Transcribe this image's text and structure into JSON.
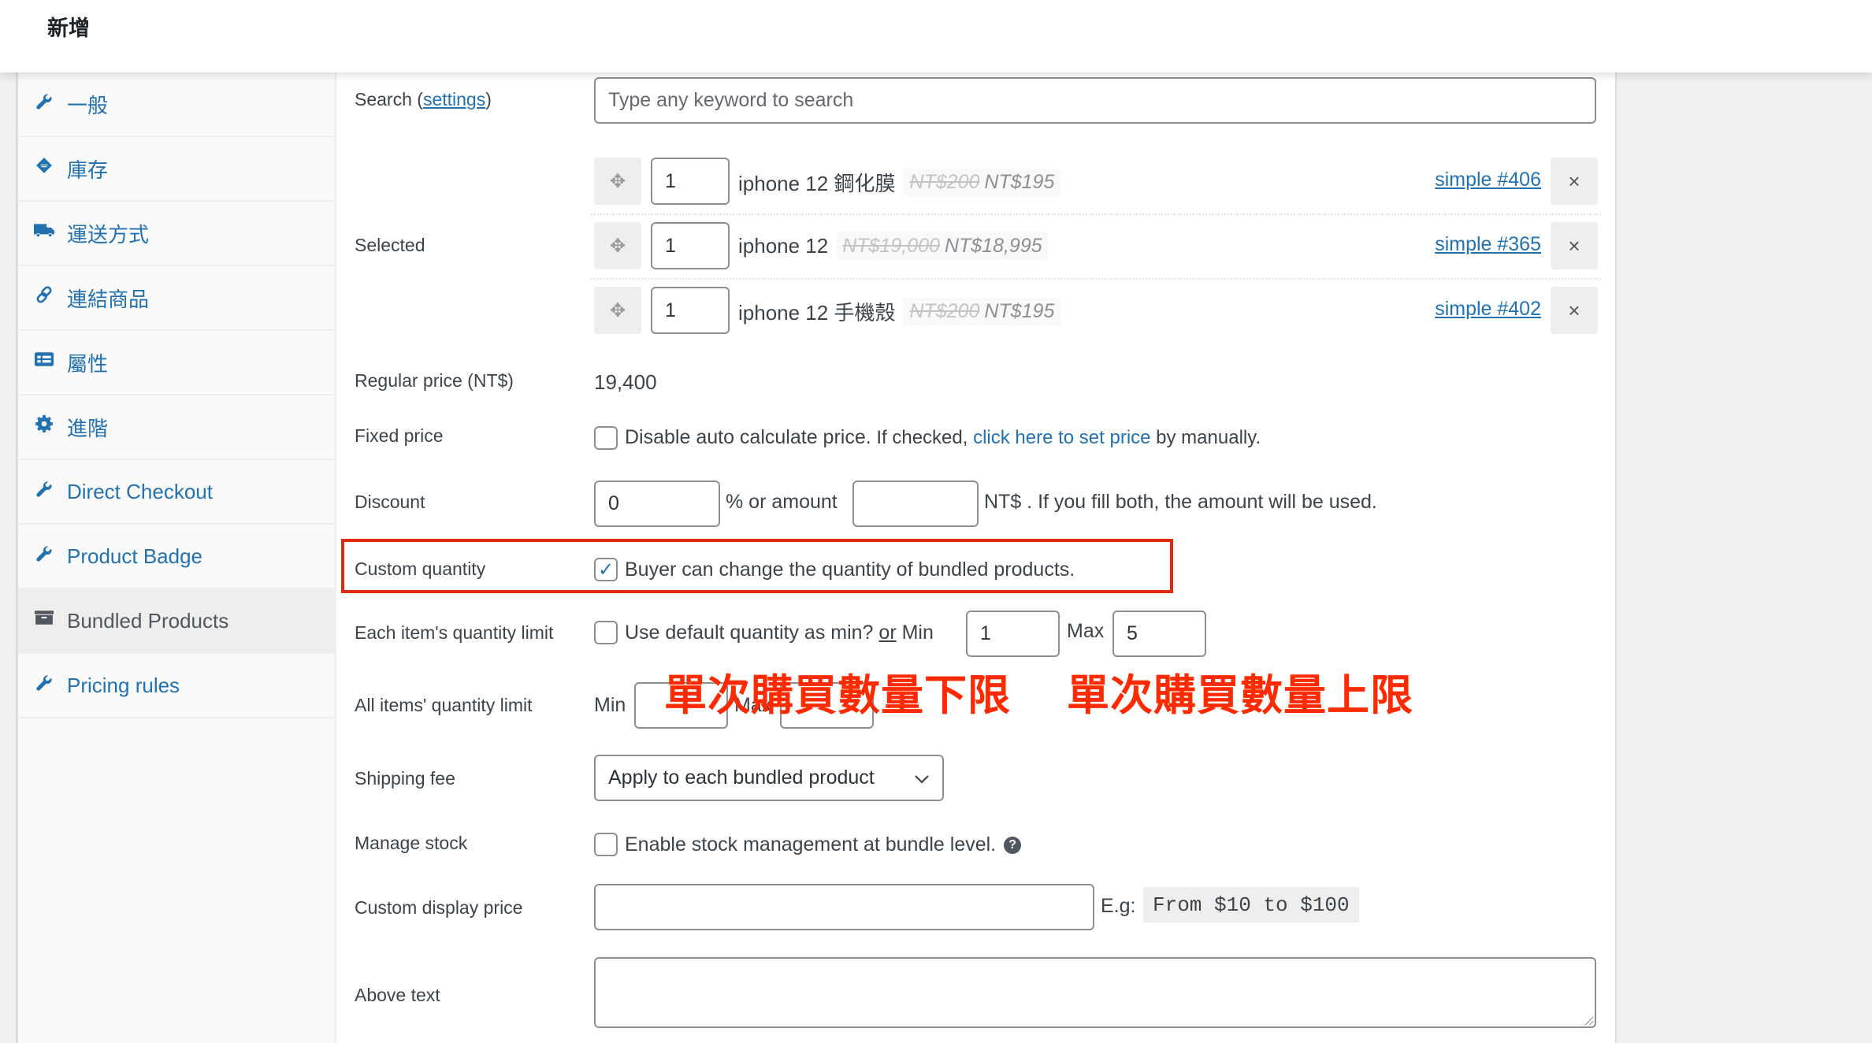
{
  "header": {
    "title": "新增"
  },
  "sidebar": {
    "items": [
      {
        "label": "一般",
        "icon": "wrench-icon",
        "active": false
      },
      {
        "label": "庫存",
        "icon": "tag-icon",
        "active": false
      },
      {
        "label": "運送方式",
        "icon": "truck-icon",
        "active": false
      },
      {
        "label": "連結商品",
        "icon": "link-icon",
        "active": false
      },
      {
        "label": "屬性",
        "icon": "list-icon",
        "active": false
      },
      {
        "label": "進階",
        "icon": "gear-icon",
        "active": false
      },
      {
        "label": "Direct Checkout",
        "icon": "wrench-icon",
        "active": false
      },
      {
        "label": "Product Badge",
        "icon": "wrench-icon",
        "active": false
      },
      {
        "label": "Bundled Products",
        "icon": "archive-box-icon",
        "active": true
      },
      {
        "label": "Pricing rules",
        "icon": "wrench-icon",
        "active": false
      }
    ]
  },
  "search": {
    "label": "Search (",
    "settings_link": "settings",
    "label_end": ")",
    "placeholder": "Type any keyword to search"
  },
  "selected": {
    "label": "Selected",
    "products": [
      {
        "qty": "1",
        "name": "iphone 12 鋼化膜",
        "regular_price": "NT$200",
        "sale_price": "NT$195",
        "link": "simple #406",
        "remove": "×"
      },
      {
        "qty": "1",
        "name": "iphone 12",
        "regular_price": "NT$19,000",
        "sale_price": "NT$18,995",
        "link": "simple #365",
        "remove": "×"
      },
      {
        "qty": "1",
        "name": "iphone 12 手機殼",
        "regular_price": "NT$200",
        "sale_price": "NT$195",
        "link": "simple #402",
        "remove": "×"
      }
    ]
  },
  "regular_price": {
    "label": "Regular price (NT$)",
    "value": "19,400"
  },
  "fixed_price": {
    "label": "Fixed price",
    "checked": false,
    "text": "Disable auto calculate price.",
    "text2": " If checked, ",
    "link": "click here to set price",
    "text3": " by manually."
  },
  "discount": {
    "label": "Discount",
    "percent_value": "0",
    "mid_text": "% or amount",
    "amount_value": "",
    "end_text": "NT$ . If you fill both, the amount will be used."
  },
  "custom_quantity": {
    "label": "Custom quantity",
    "checked": true,
    "text": "Buyer can change the quantity of bundled products."
  },
  "each_item_limit": {
    "label": "Each item's quantity limit",
    "checked": false,
    "text": "Use default quantity as min?",
    "or": "or",
    "min_label": "Min",
    "min_value": "1",
    "max_label": "Max",
    "max_value": "5"
  },
  "all_items_limit": {
    "label": "All items' quantity limit",
    "min_label": "Min",
    "min_value": "",
    "max_label": "Max",
    "max_value": ""
  },
  "annotations": {
    "min_note": "單次購買數量下限",
    "max_note": "單次購買數量上限",
    "color": "#ff2a00"
  },
  "shipping_fee": {
    "label": "Shipping fee",
    "selected": "Apply to each bundled product"
  },
  "manage_stock": {
    "label": "Manage stock",
    "checked": false,
    "text": "Enable stock management at bundle level.",
    "help": "?"
  },
  "custom_display_price": {
    "label": "Custom display price",
    "value": "",
    "eg_label": "E.g:",
    "example": "From $10 to $100"
  },
  "above_text": {
    "label": "Above text",
    "value": ""
  },
  "colors": {
    "link": "#2271b1",
    "highlight_box": "#e22a0c"
  }
}
